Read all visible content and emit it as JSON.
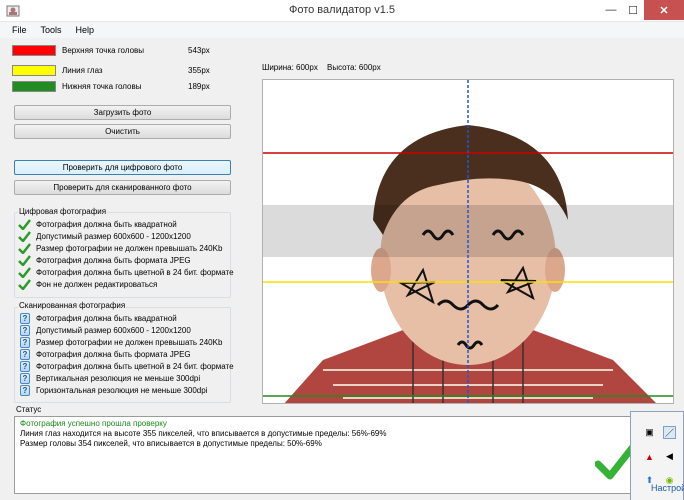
{
  "window": {
    "title": "Фото валидатор v1.5"
  },
  "menu": [
    "File",
    "Tools",
    "Help"
  ],
  "legend": [
    {
      "label": "Верхняя точка головы",
      "value": "543px",
      "color": "#ff0000"
    },
    {
      "label": "Линия глаз",
      "value": "355px",
      "color": "#ffff00"
    },
    {
      "label": "Нижняя точка головы",
      "value": "189px",
      "color": "#228b22"
    }
  ],
  "buttons": {
    "load": "Загрузить фото",
    "clear": "Очистить",
    "check_digital": "Проверить для цифрового фото",
    "check_scanned": "Проверить для сканированного фото"
  },
  "digital_group": {
    "title": "Цифровая фотография",
    "items": [
      "Фотография должна быть квадратной",
      "Допустимый размер 600x600 - 1200x1200",
      "Размер фотографии не должен превышать 240Kb",
      "Фотография должна быть формата JPEG",
      "Фотография должна быть цветной в 24 бит. формате",
      "Фон не должен редактироваться"
    ]
  },
  "scanned_group": {
    "title": "Сканированная фотография",
    "items": [
      "Фотография должна быть квадратной",
      "Допустимый размер 600x600 - 1200x1200",
      "Размер фотографии не должен превышать 240Kb",
      "Фотография должна быть формата JPEG",
      "Фотография должна быть цветной в 24 бит. формате",
      "Вертикальная резолюция не меньше 300dpi",
      "Горизонтальная резолюция не меньше 300dpi"
    ]
  },
  "image_size": {
    "width": "Ширина: 600px",
    "height": "Высота: 600px"
  },
  "status": {
    "title": "Статус",
    "lines": [
      "Фотография успешно прошла проверку",
      "Линия глаз находится на высоте 355 пикселей, что вписывается в допустимые пределы: 56%-69%",
      "Размер головы 354 пикселей, что вписывается в допустимые пределы: 50%-69%"
    ],
    "success_color": "#1a8a1a"
  },
  "tray": {
    "customize": "Настрой"
  }
}
